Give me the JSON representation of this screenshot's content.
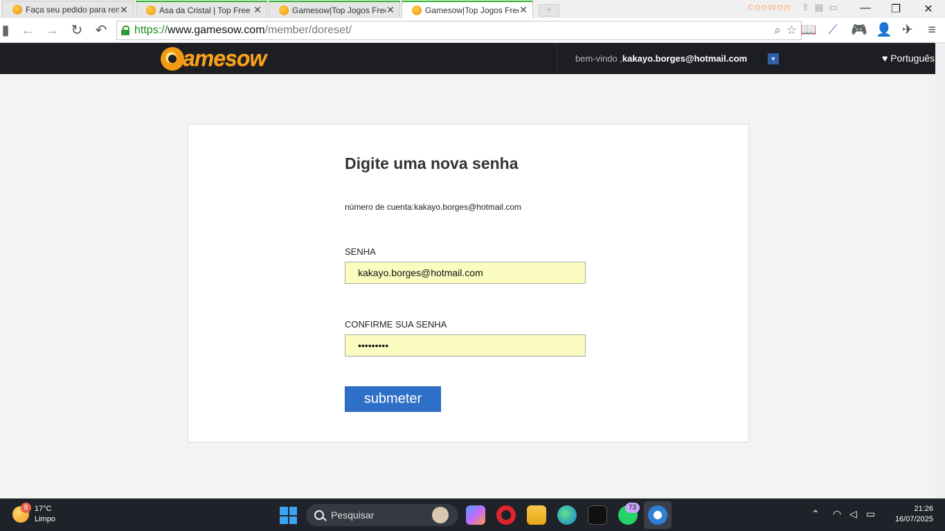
{
  "browser": {
    "tabs": [
      {
        "title": "Faça seu pedido para rem"
      },
      {
        "title": "Asa da Cristal | Top Free G"
      },
      {
        "title": "Gamesow|Top Jogos Free"
      },
      {
        "title": "Gamesow|Top Jogos Free"
      }
    ],
    "brand": "coowon",
    "url": {
      "scheme": "https://",
      "host": "www.gamesow.com",
      "path": "/member/doreset/"
    }
  },
  "site": {
    "logo_text": "amesow",
    "welcome_label": "bem-vindo ,",
    "account_email": "kakayo.borges@hotmail.com",
    "language": "♥ Português"
  },
  "form": {
    "title": "Digite uma nova senha",
    "account_line": "número de cuenta:kakayo.borges@hotmail.com",
    "password_label": "SENHA",
    "password_value": "kakayo.borges@hotmail.com",
    "confirm_label": "CONFIRME SUA SENHA",
    "confirm_value": "•••••••••",
    "submit_label": "submeter"
  },
  "taskbar": {
    "weather_badge": "8",
    "temperature": "17°C",
    "condition": "Limpo",
    "search_placeholder": "Pesquisar",
    "whatsapp_badge": "73",
    "time": "21:26",
    "date": "16/07/2025"
  },
  "colors": {
    "header_bg": "#1c1e24",
    "brand_orange": "#f7a21b",
    "input_bg": "#fbfdc0",
    "button_blue": "#2e6fc8",
    "taskbar_bg": "#1f2229"
  }
}
